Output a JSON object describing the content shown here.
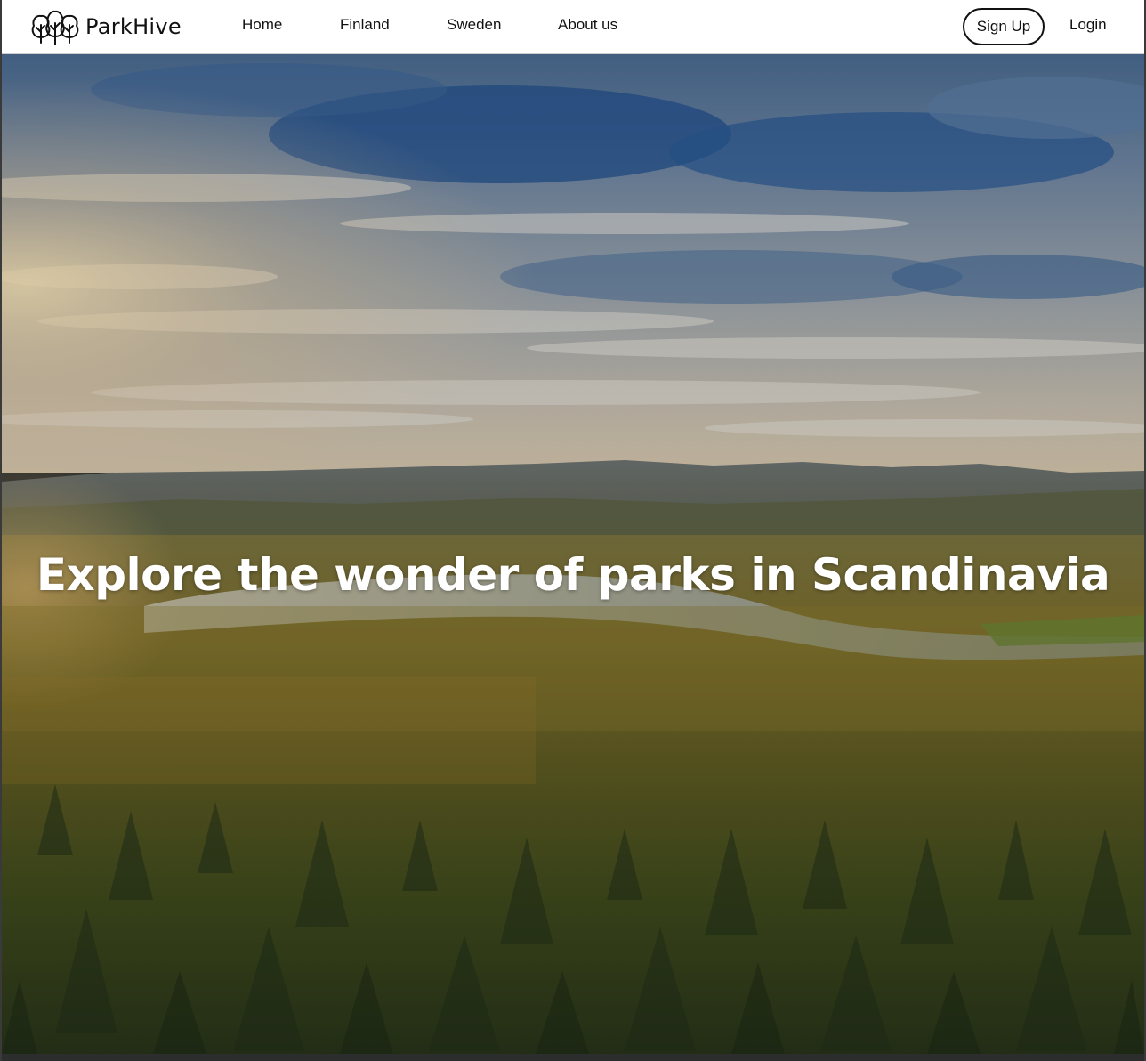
{
  "brand": {
    "name": "ParkHive",
    "logo_icon": "trees-icon"
  },
  "nav": {
    "items": [
      {
        "label": "Home"
      },
      {
        "label": "Finland"
      },
      {
        "label": "Sweden"
      },
      {
        "label": "About us"
      }
    ],
    "signup_label": "Sign Up",
    "login_label": "Login"
  },
  "hero": {
    "title": "Explore the wonder of parks in Scandinavia",
    "image_description_icon": "forest-landscape-image"
  },
  "colors": {
    "nav_background": "#ffffff",
    "text": "#111111",
    "hero_title": "#ffffff",
    "sky_blue": "#2f5f9e",
    "forest_green": "#3d4a1c"
  }
}
